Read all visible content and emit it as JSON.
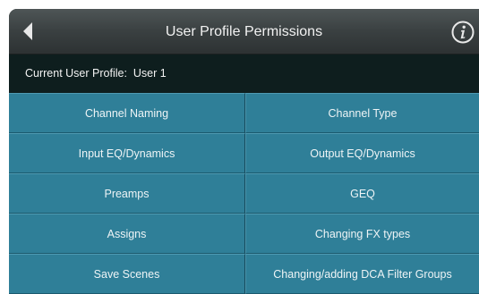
{
  "header": {
    "title": "User Profile Permissions",
    "back_icon": "back-arrow-icon",
    "info_icon": "info-icon"
  },
  "profile": {
    "label": "Current User Profile:  User 1"
  },
  "permissions": [
    "Channel Naming",
    "Channel Type",
    "Input EQ/Dynamics",
    "Output EQ/Dynamics",
    "Preamps",
    "GEQ",
    "Assigns",
    "Changing FX types",
    "Save Scenes",
    "Changing/adding DCA Filter Groups"
  ],
  "colors": {
    "header": "#3a4041",
    "profile_bar": "#0e1e1e",
    "button": "#2f7f98",
    "text": "#ffffff"
  }
}
